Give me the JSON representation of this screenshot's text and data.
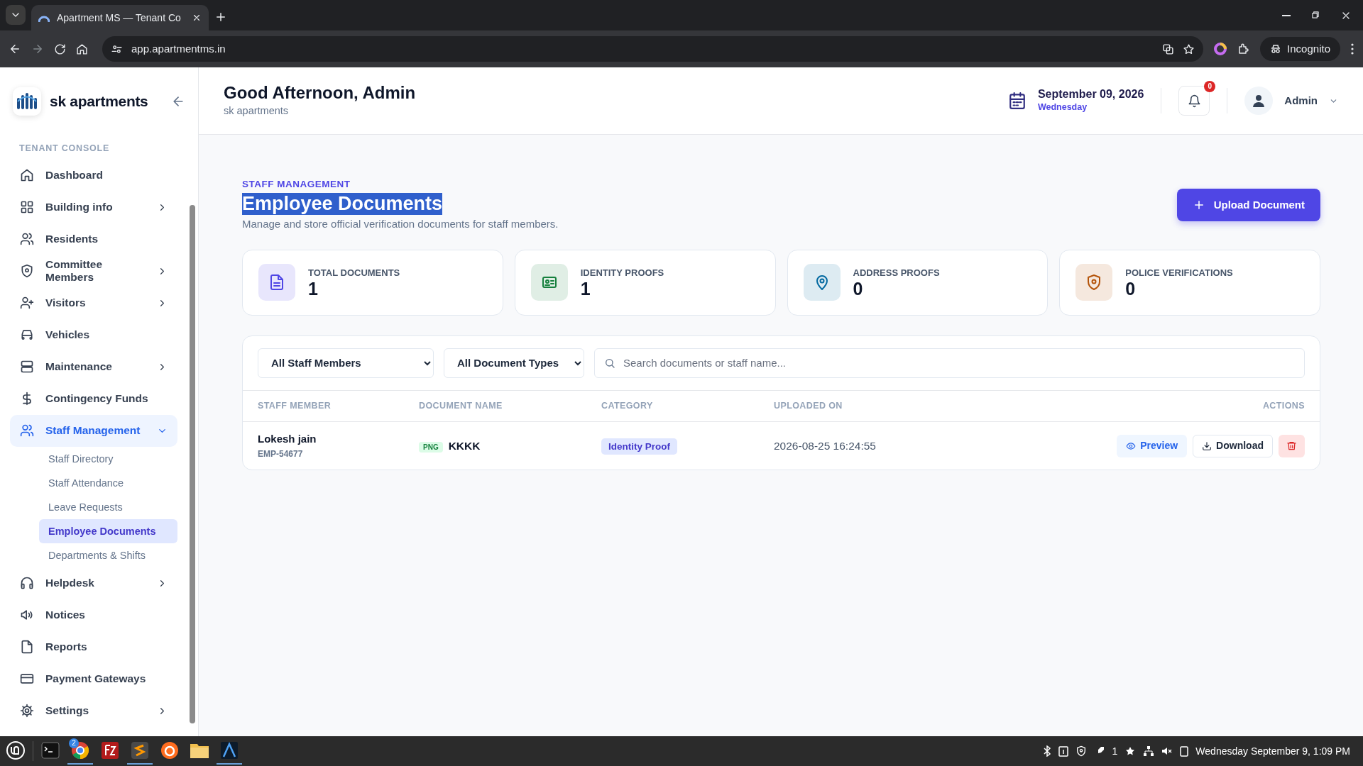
{
  "browser": {
    "tab_title": "Apartment MS — Tenant Co",
    "url": "app.apartmentms.in",
    "profile": "Incognito"
  },
  "sidebar": {
    "brand": "sk apartments",
    "section": "TENANT CONSOLE",
    "items": [
      {
        "label": "Dashboard",
        "submenu": false,
        "expanded": false,
        "selected": false
      },
      {
        "label": "Building info",
        "submenu": true,
        "expanded": false,
        "selected": false
      },
      {
        "label": "Residents",
        "submenu": false,
        "expanded": false,
        "selected": false
      },
      {
        "label": "Committee Members",
        "submenu": true,
        "expanded": false,
        "selected": false
      },
      {
        "label": "Visitors",
        "submenu": true,
        "expanded": false,
        "selected": false
      },
      {
        "label": "Vehicles",
        "submenu": false,
        "expanded": false,
        "selected": false
      },
      {
        "label": "Maintenance",
        "submenu": true,
        "expanded": false,
        "selected": false
      },
      {
        "label": "Contingency Funds",
        "submenu": false,
        "expanded": false,
        "selected": false
      },
      {
        "label": "Staff Management",
        "submenu": true,
        "expanded": true,
        "selected": true,
        "children": [
          {
            "label": "Staff Directory",
            "selected": false
          },
          {
            "label": "Staff Attendance",
            "selected": false
          },
          {
            "label": "Leave Requests",
            "selected": false
          },
          {
            "label": "Employee Documents",
            "selected": true
          },
          {
            "label": "Departments & Shifts",
            "selected": false
          }
        ]
      },
      {
        "label": "Helpdesk",
        "submenu": true,
        "expanded": false,
        "selected": false
      },
      {
        "label": "Notices",
        "submenu": false,
        "expanded": false,
        "selected": false
      },
      {
        "label": "Reports",
        "submenu": false,
        "expanded": false,
        "selected": false
      },
      {
        "label": "Payment Gateways",
        "submenu": false,
        "expanded": false,
        "selected": false
      },
      {
        "label": "Settings",
        "submenu": true,
        "expanded": false,
        "selected": false
      }
    ]
  },
  "header": {
    "greeting": "Good Afternoon, Admin",
    "subtitle": "sk apartments",
    "date": "September 09, 2026",
    "weekday": "Wednesday",
    "notification_count": "0",
    "user": "Admin"
  },
  "page": {
    "eyebrow": "STAFF MANAGEMENT",
    "title": "Employee Documents",
    "title_highlighted": true,
    "description": "Manage and store official verification documents for staff members.",
    "upload_button": "Upload Document"
  },
  "stats": [
    {
      "label": "TOTAL DOCUMENTS",
      "value": "1",
      "color": "#4f46e5"
    },
    {
      "label": "IDENTITY PROOFS",
      "value": "1",
      "color": "#15803d"
    },
    {
      "label": "ADDRESS PROOFS",
      "value": "0",
      "color": "#0369a1"
    },
    {
      "label": "POLICE VERIFICATIONS",
      "value": "0",
      "color": "#b45309"
    }
  ],
  "filters": {
    "staff": "All Staff Members",
    "type": "All Document Types",
    "search_placeholder": "Search documents or staff name..."
  },
  "table": {
    "columns": [
      "STAFF MEMBER",
      "DOCUMENT NAME",
      "CATEGORY",
      "UPLOADED ON",
      "ACTIONS"
    ],
    "rows": [
      {
        "staff": "Lokesh jain",
        "employee_id": "EMP-54677",
        "file_type": "PNG",
        "document": "KKKK",
        "category": "Identity Proof",
        "uploaded_on": "2026-08-25 16:24:55",
        "preview": "Preview",
        "download": "Download"
      }
    ]
  },
  "taskbar": {
    "browser_badge": "2",
    "tray_count": "1",
    "clock": "Wednesday September 9, 1:09 PM"
  }
}
